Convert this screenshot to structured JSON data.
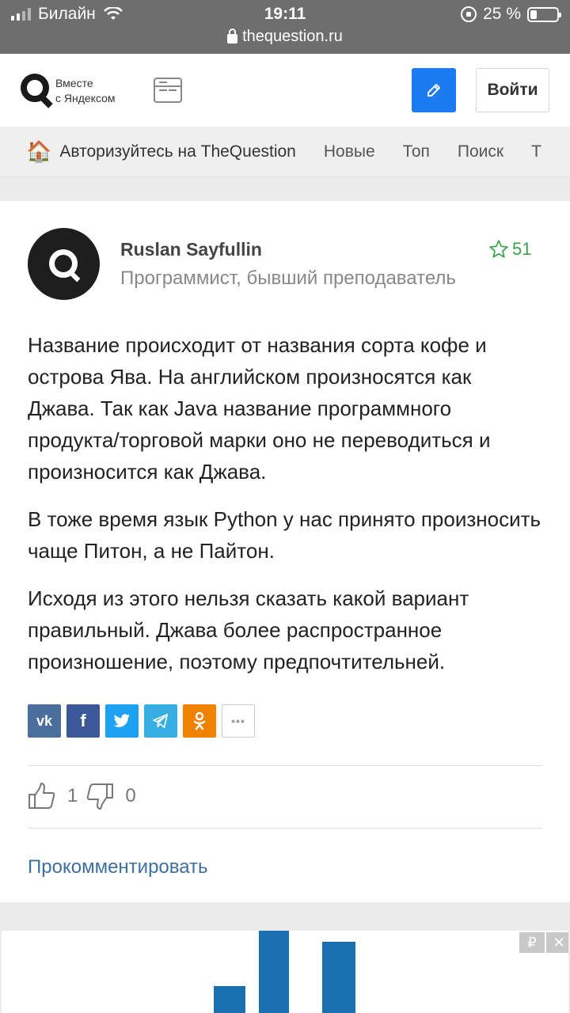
{
  "status_bar": {
    "carrier": "Билайн",
    "time": "19:11",
    "battery": "25 %",
    "url": "thequestion.ru"
  },
  "header": {
    "logo_line1": "Вместе",
    "logo_line2": "с Яндексом",
    "login_label": "Войти",
    "accent_color": "#1a7cf0"
  },
  "nav": {
    "items": [
      "Авторизуйтесь на TheQuestion",
      "Новые",
      "Топ",
      "Поиск",
      "Т"
    ]
  },
  "answer": {
    "author_name": "Ruslan Sayfullin",
    "author_role": "Программист, бывший преподаватель",
    "rating": "51",
    "paragraphs": [
      "Название происходит от названия сорта кофе и острова Ява. На английском произносятся как Джава. Так как Java название программного продукта/торговой марки оно не переводиться и произносится как Джава.",
      "В тоже время язык Python у нас принято произносить чаще Питон, а не Пайтон.",
      "Исходя из этого нельзя сказать какой вариант правильный. Джава более распространное произношение, поэтому предпочтительней."
    ],
    "likes": "1",
    "dislikes": "0",
    "comment_label": "Прокомментировать"
  },
  "share": {
    "vk": "vk",
    "fb": "f",
    "ok": "ok",
    "more": "•••"
  },
  "ad": {
    "ruble": "₽",
    "close": "✕"
  }
}
